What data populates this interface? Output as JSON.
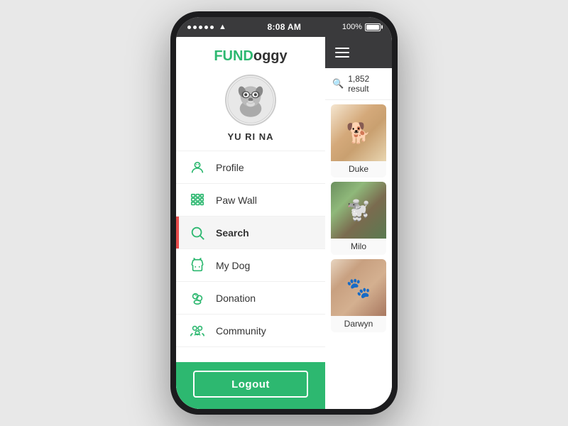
{
  "statusBar": {
    "time": "8:08 AM",
    "battery": "100%"
  },
  "app": {
    "logo": {
      "fund": "FUND",
      "oggy": "oggy"
    },
    "username": "YU RI NA"
  },
  "nav": {
    "items": [
      {
        "id": "profile",
        "label": "Profile",
        "icon": "profile-icon",
        "active": false
      },
      {
        "id": "paw-wall",
        "label": "Paw Wall",
        "icon": "paw-wall-icon",
        "active": false
      },
      {
        "id": "search",
        "label": "Search",
        "icon": "search-icon",
        "active": true
      },
      {
        "id": "my-dog",
        "label": "My Dog",
        "icon": "my-dog-icon",
        "active": false
      },
      {
        "id": "donation",
        "label": "Donation",
        "icon": "donation-icon",
        "active": false
      },
      {
        "id": "community",
        "label": "Community",
        "icon": "community-icon",
        "active": false
      }
    ],
    "logout": "Logout"
  },
  "main": {
    "searchResultCount": "1,852 result",
    "dogs": [
      {
        "name": "Duke",
        "photoClass": "dog-duke"
      },
      {
        "name": "Milo",
        "photoClass": "dog-milo"
      },
      {
        "name": "Darwyn",
        "photoClass": "dog-darwyn"
      }
    ]
  }
}
